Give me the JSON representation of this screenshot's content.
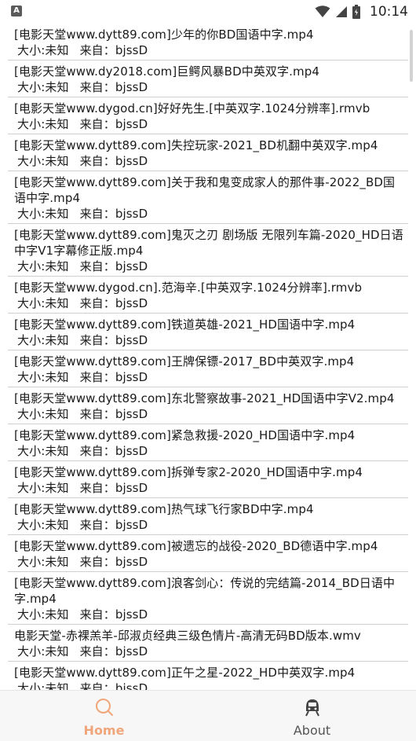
{
  "status_bar": {
    "time": "10:14",
    "app_icon_letter": "A",
    "icons": [
      "wifi-icon",
      "signal-icon",
      "battery-icon"
    ]
  },
  "file_list": {
    "items": [
      {
        "name": "[电影天堂www.dytt89.com]少年的你BD国语中字.mp4",
        "size_label": "大小:未知",
        "source_label": "来自：bjssD"
      },
      {
        "name": "[电影天堂www.dy2018.com]巨鳄风暴BD中英双字.mp4",
        "size_label": "大小:未知",
        "source_label": "来自：bjssD"
      },
      {
        "name": "[电影天堂www.dygod.cn]好好先生.[中英双字.1024分辨率].rmvb",
        "size_label": "大小:未知",
        "source_label": "来自：bjssD"
      },
      {
        "name": "[电影天堂www.dytt89.com]失控玩家-2021_BD机翻中英双字.mp4",
        "size_label": "大小:未知",
        "source_label": "来自：bjssD"
      },
      {
        "name": "[电影天堂www.dytt89.com]关于我和鬼变成家人的那件事-2022_BD国语中字.mp4",
        "size_label": "大小:未知",
        "source_label": "来自：bjssD"
      },
      {
        "name": "[电影天堂www.dytt89.com]鬼灭之刃 剧场版 无限列车篇-2020_HD日语中字V1字幕修正版.mp4",
        "size_label": "大小:未知",
        "source_label": "来自：bjssD"
      },
      {
        "name": "[电影天堂www.dygod.cn].范海辛.[中英双字.1024分辨率].rmvb",
        "size_label": "大小:未知",
        "source_label": "来自：bjssD"
      },
      {
        "name": "[电影天堂www.dytt89.com]铁道英雄-2021_HD国语中字.mp4",
        "size_label": "大小:未知",
        "source_label": "来自：bjssD"
      },
      {
        "name": "[电影天堂www.dytt89.com]王牌保镖-2017_BD中英双字.mp4",
        "size_label": "大小:未知",
        "source_label": "来自：bjssD"
      },
      {
        "name": "[电影天堂www.dytt89.com]东北警察故事-2021_HD国语中字V2.mp4",
        "size_label": "大小:未知",
        "source_label": "来自：bjssD"
      },
      {
        "name": "[电影天堂www.dytt89.com]紧急救援-2020_HD国语中字.mp4",
        "size_label": "大小:未知",
        "source_label": "来自：bjssD"
      },
      {
        "name": "[电影天堂www.dytt89.com]拆弹专家2-2020_HD国语中字.mp4",
        "size_label": "大小:未知",
        "source_label": "来自：bjssD"
      },
      {
        "name": "[电影天堂www.dytt89.com]热气球飞行家BD中字.mp4",
        "size_label": "大小:未知",
        "source_label": "来自：bjssD"
      },
      {
        "name": "[电影天堂www.dytt89.com]被遗忘的战役-2020_BD德语中字.mp4",
        "size_label": "大小:未知",
        "source_label": "来自：bjssD"
      },
      {
        "name": "[电影天堂www.dytt89.com]浪客剑心：传说的完结篇-2014_BD日语中字.mp4",
        "size_label": "大小:未知",
        "source_label": "来自：bjssD"
      },
      {
        "name": "电影天堂-赤裸羔羊-邱淑贞经典三级色情片-高清无码BD版本.wmv",
        "size_label": "大小:未知",
        "source_label": "来自：bjssD"
      },
      {
        "name": "[电影天堂www.dytt89.com]正午之星-2022_HD中英双字.mp4",
        "size_label": "大小:未知",
        "source_label": "来自：bjssD"
      }
    ]
  },
  "bottom_nav": {
    "tabs": [
      {
        "label": "Home",
        "icon": "search-icon",
        "active": true
      },
      {
        "label": "About",
        "icon": "train-icon",
        "active": false
      }
    ],
    "colors": {
      "active": "#f0a67a",
      "inactive": "#555555"
    }
  }
}
